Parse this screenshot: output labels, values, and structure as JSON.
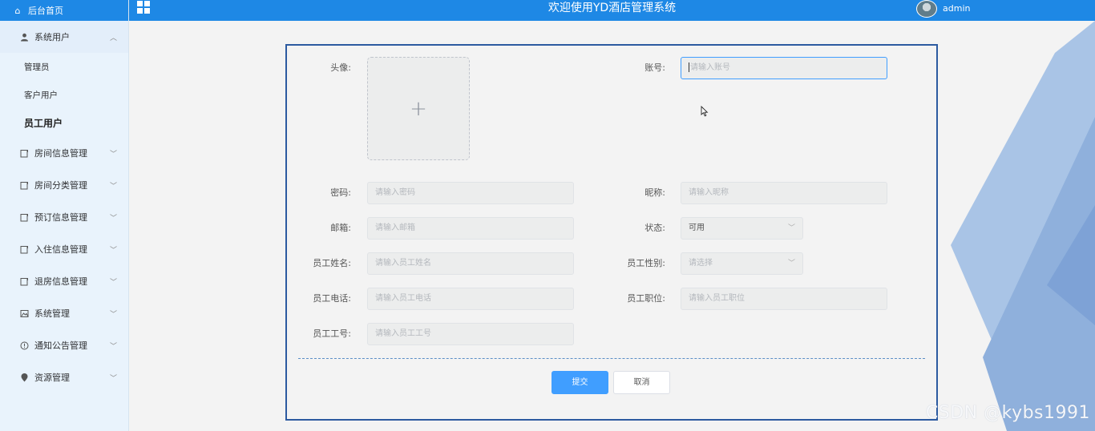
{
  "app": {
    "title": "欢迎使用YD酒店管理系统",
    "username": "admin"
  },
  "sidebar": {
    "home_label": "后台首页",
    "groups": [
      {
        "label": "系统用户",
        "expanded": true,
        "icon": "user-icon"
      },
      {
        "label": "房间信息管理",
        "icon": "doc-icon"
      },
      {
        "label": "房间分类管理",
        "icon": "doc-icon"
      },
      {
        "label": "预订信息管理",
        "icon": "doc-icon"
      },
      {
        "label": "入住信息管理",
        "icon": "doc-icon"
      },
      {
        "label": "退房信息管理",
        "icon": "doc-icon"
      },
      {
        "label": "系统管理",
        "icon": "picture-icon"
      },
      {
        "label": "通知公告管理",
        "icon": "info-icon"
      },
      {
        "label": "资源管理",
        "icon": "location-icon"
      }
    ],
    "sub_items": [
      {
        "label": "管理员"
      },
      {
        "label": "客户用户"
      },
      {
        "label": "员工用户",
        "active": true
      }
    ]
  },
  "form": {
    "avatar_label": "头像:",
    "account_label": "账号:",
    "account_placeholder": "请输入账号",
    "password_label": "密码:",
    "password_placeholder": "请输入密码",
    "nickname_label": "昵称:",
    "nickname_placeholder": "请输入昵称",
    "email_label": "邮箱:",
    "email_placeholder": "请输入邮箱",
    "status_label": "状态:",
    "status_value": "可用",
    "name_label": "员工姓名:",
    "name_placeholder": "请输入员工姓名",
    "gender_label": "员工性别:",
    "gender_placeholder": "请选择",
    "phone_label": "员工电话:",
    "phone_placeholder": "请输入员工电话",
    "position_label": "员工职位:",
    "position_placeholder": "请输入员工职位",
    "number_label": "员工工号:",
    "number_placeholder": "请输入员工工号",
    "submit_label": "提交",
    "cancel_label": "取消"
  },
  "watermark": "CSDN @kybs1991",
  "colors": {
    "header": "#1e88e5",
    "sidebar_bg": "#e9f3fc",
    "primary": "#409eff",
    "card_border": "#2c5aa0"
  }
}
